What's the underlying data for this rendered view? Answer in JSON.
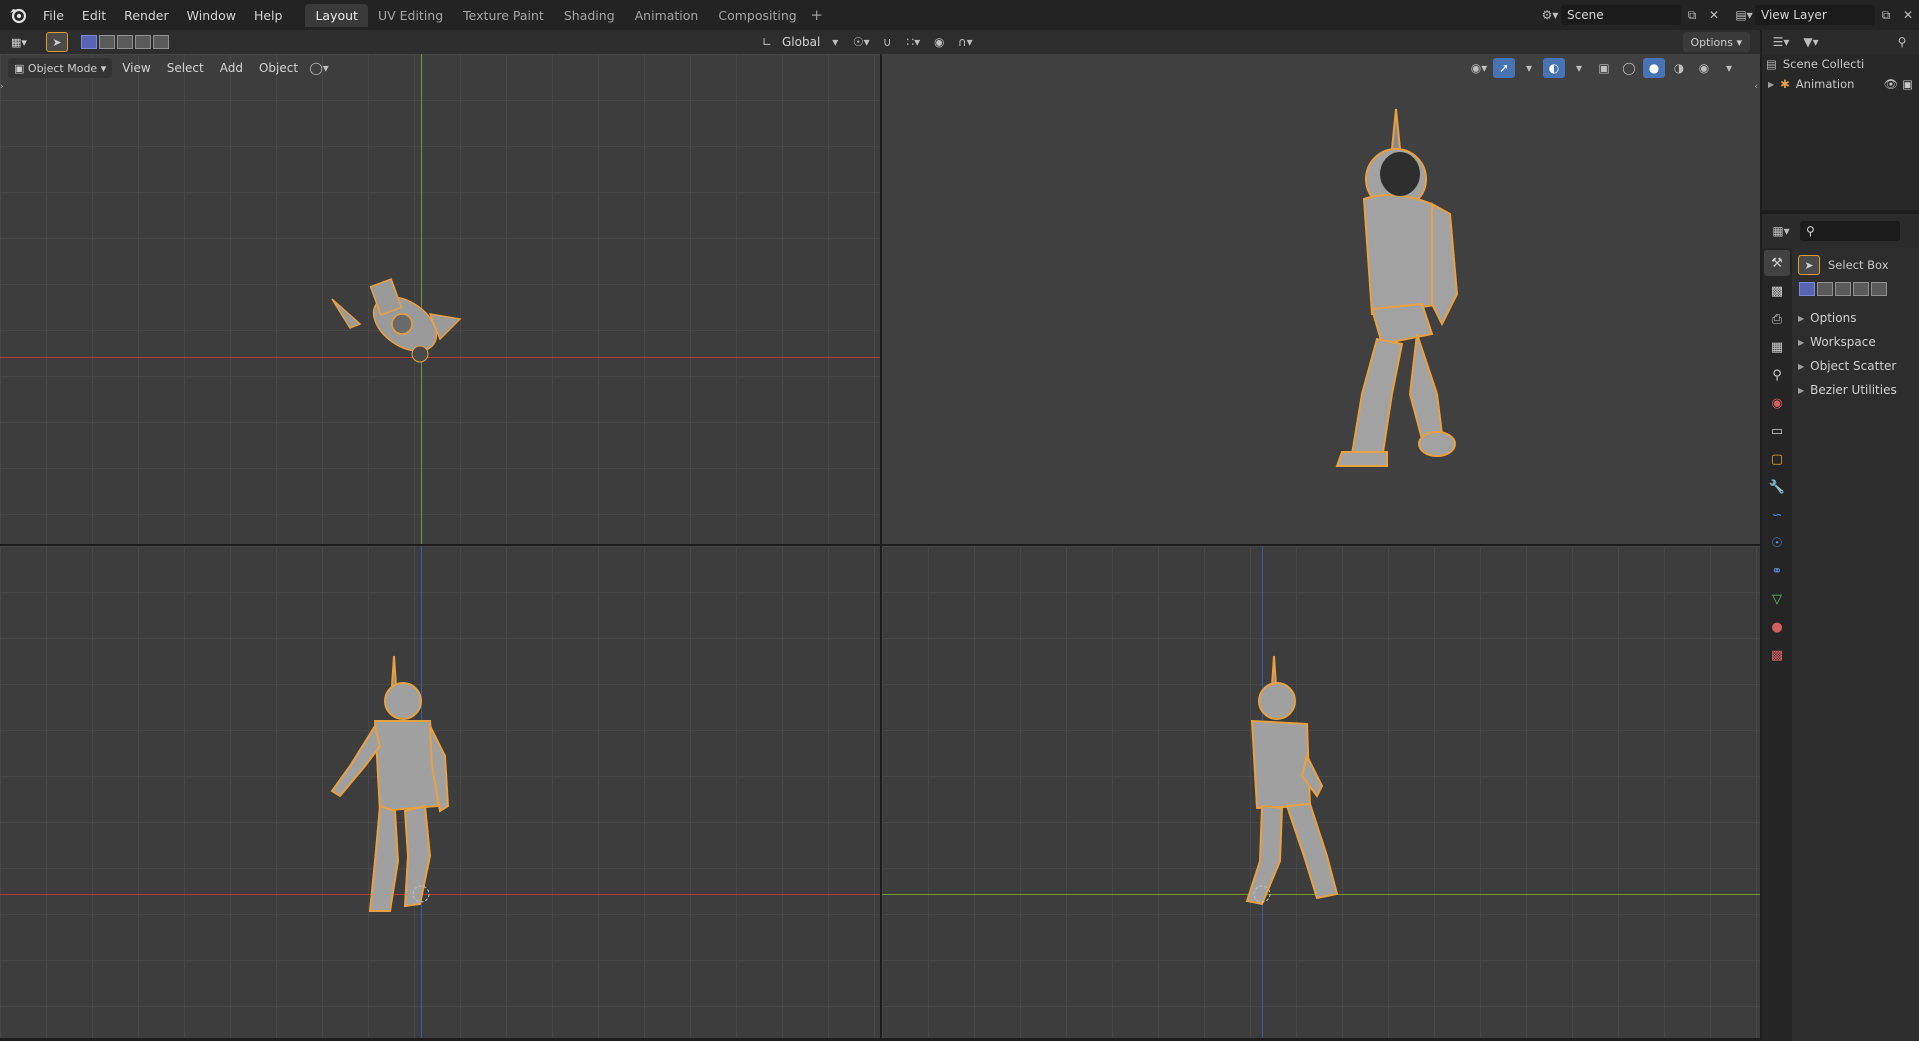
{
  "topbar": {
    "menus": [
      "File",
      "Edit",
      "Render",
      "Window",
      "Help"
    ],
    "workspace_tabs": [
      "Layout",
      "UV Editing",
      "Texture Paint",
      "Shading",
      "Animation",
      "Compositing"
    ],
    "active_tab": "Layout",
    "scene_name": "Scene",
    "view_layer_name": "View Layer"
  },
  "editor": {
    "transform_orientation": "Global",
    "options_label": "Options"
  },
  "viewport": {
    "mode_label": "Object Mode",
    "menus": [
      "View",
      "Select",
      "Add",
      "Object"
    ]
  },
  "outliner": {
    "collection_label": "Scene Collecti",
    "object_label": "Animation"
  },
  "properties": {
    "tool_label": "Select Box",
    "panels": [
      "Options",
      "Workspace",
      "Object Scatter",
      "Bezier Utilities"
    ]
  },
  "colors": {
    "axis_x": "#b13a3a",
    "axis_y": "#6f9a2a",
    "axis_z": "#2f5fae",
    "selection_outline": "#e8a040",
    "accent": "#4772b3"
  }
}
